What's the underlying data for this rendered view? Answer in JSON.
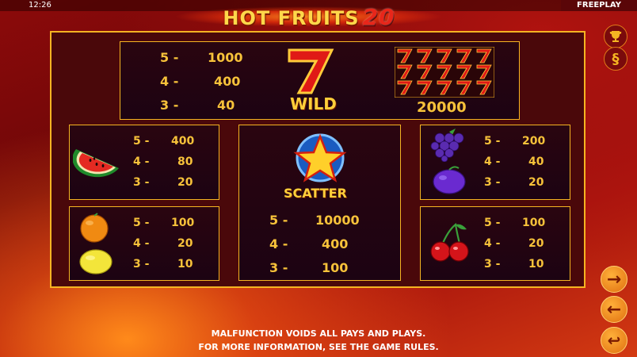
{
  "status": {
    "time": "12:26",
    "mode": "FREEPLAY"
  },
  "logo": {
    "title": "HOT FRUITS",
    "number": "20"
  },
  "wild": {
    "label": "WILD",
    "pays": [
      {
        "count": "5 -",
        "value": "1000"
      },
      {
        "count": "4 -",
        "value": "400"
      },
      {
        "count": "3 -",
        "value": "40"
      }
    ],
    "grid_symbol": "7",
    "full_screen_win": "20000"
  },
  "scatter": {
    "label": "SCATTER",
    "pays": [
      {
        "count": "5 -",
        "value": "10000"
      },
      {
        "count": "4 -",
        "value": "400"
      },
      {
        "count": "3 -",
        "value": "100"
      }
    ]
  },
  "watermelon": {
    "pays": [
      {
        "count": "5 -",
        "value": "400"
      },
      {
        "count": "4 -",
        "value": "80"
      },
      {
        "count": "3 -",
        "value": "20"
      }
    ]
  },
  "grapes_plum": {
    "pays": [
      {
        "count": "5 -",
        "value": "200"
      },
      {
        "count": "4 -",
        "value": "40"
      },
      {
        "count": "3 -",
        "value": "20"
      }
    ]
  },
  "orange_lemon": {
    "pays": [
      {
        "count": "5 -",
        "value": "100"
      },
      {
        "count": "4 -",
        "value": "20"
      },
      {
        "count": "3 -",
        "value": "10"
      }
    ]
  },
  "cherries": {
    "pays": [
      {
        "count": "5 -",
        "value": "100"
      },
      {
        "count": "4 -",
        "value": "20"
      },
      {
        "count": "3 -",
        "value": "10"
      }
    ]
  },
  "footer": {
    "line1": "MALFUNCTION VOIDS ALL PAYS AND PLAYS.",
    "line2": "FOR MORE INFORMATION, SEE THE GAME RULES."
  },
  "buttons": {
    "trophy": "trophy-icon",
    "rules": "§",
    "next": "→",
    "prev": "←",
    "back": "↩"
  }
}
